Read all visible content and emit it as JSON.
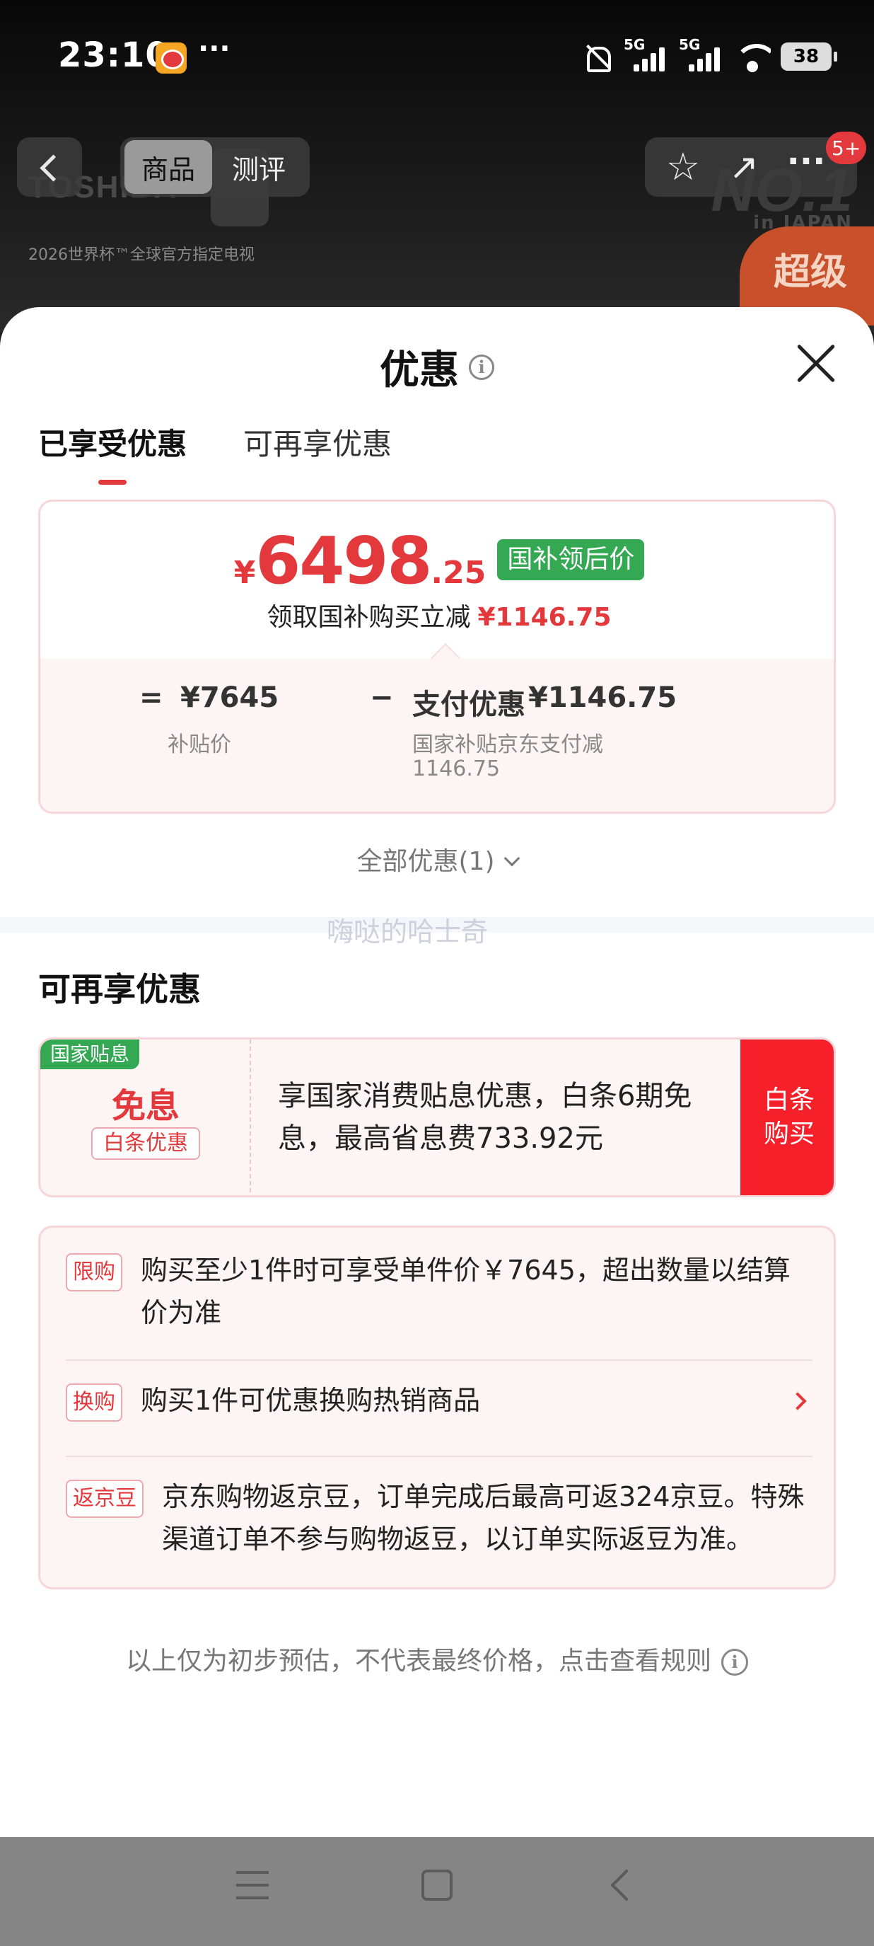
{
  "status_bar": {
    "time": "23:10",
    "dots": "···",
    "signal1": "5G",
    "signal2": "5G",
    "battery": "38"
  },
  "product_header": {
    "brand": "TOSHIBA",
    "brand_sub": "2026世界杯™全球官方指定电视",
    "rank": "NO.1",
    "rank_sub": "in JAPAN",
    "promo_badge": "超级",
    "tabs": [
      "商品",
      "测评"
    ],
    "message_badge": "5+"
  },
  "sheet": {
    "title": "优惠",
    "tabs": [
      "已享受优惠",
      "可再享优惠"
    ],
    "price_card": {
      "currency": "¥",
      "price_int": "6498",
      "price_dec": ".25",
      "price_tag": "国补领后价",
      "reduce_text": "领取国补购买立减",
      "reduce_amount": "¥1146.75",
      "equals": "=",
      "base_price": "¥7645",
      "base_label": "补贴价",
      "minus": "−",
      "discount_label": "支付优惠",
      "discount_amount": "¥1146.75",
      "discount_desc_line1": "国家补贴京东支付减",
      "discount_desc_line2": "1146.75"
    },
    "all_discounts": "全部优惠(1)",
    "watermark": "嗨哒的哈士奇",
    "more_section_title": "可再享优惠",
    "coupon": {
      "corner_tag": "国家贴息",
      "title": "免息",
      "sub_tag": "白条优惠",
      "description": "享国家消费贴息优惠，白条6期免息，最高省息费733.92元",
      "button_line1": "白条",
      "button_line2": "购买"
    },
    "info_rows": [
      {
        "badge": "限购",
        "text": "购买至少1件时可享受单件价￥7645，超出数量以结算价为准"
      },
      {
        "badge": "换购",
        "text": "购买1件可优惠换购热销商品"
      },
      {
        "badge": "返京豆",
        "text": "京东购物返京豆，订单完成后最高可返324京豆。特殊渠道订单不参与购物返豆，以订单实际返豆为准。"
      }
    ],
    "footnote": "以上仅为初步预估，不代表最终价格，点击查看规则"
  },
  "colors": {
    "accent_red": "#e4393c",
    "subsidy_green": "#34a853",
    "buy_button": "#f5202a"
  }
}
